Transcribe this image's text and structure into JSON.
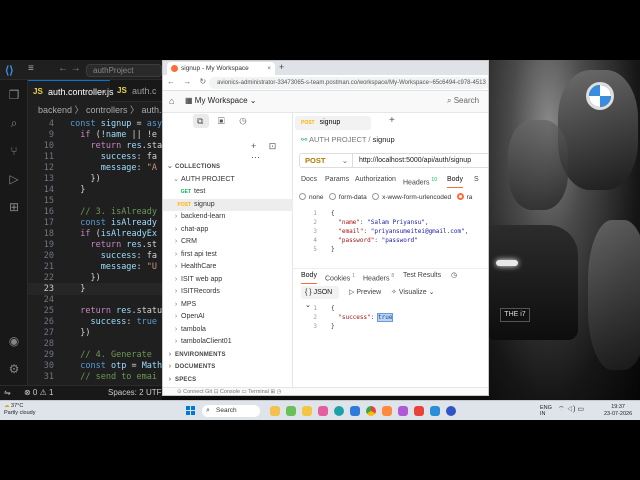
{
  "vscode": {
    "command_center": "authProject",
    "tabs": [
      {
        "label": "auth.controller.js"
      },
      {
        "label": "auth.c"
      }
    ],
    "breadcrumb": "backend 〉 controllers 〉 auth.c",
    "code": [
      {
        "n": "4",
        "html": "<span class='kw'>const</span> <span class='var'>signup</span> = <span class='kw'>async</span>"
      },
      {
        "n": "9",
        "html": "  <span class='kw2'>if</span> (!<span class='var'>name</span> || !e"
      },
      {
        "n": "10",
        "html": "    <span class='kw2'>return</span> <span class='var'>res</span>.sta"
      },
      {
        "n": "11",
        "html": "      <span class='var'>success</span>: fa"
      },
      {
        "n": "12",
        "html": "      <span class='var'>message</span>: <span class='str'>\"A</span>"
      },
      {
        "n": "13",
        "html": "    })"
      },
      {
        "n": "14",
        "html": "  }"
      },
      {
        "n": "15",
        "html": ""
      },
      {
        "n": "16",
        "html": "  <span class='cm'>// 3. isAlready</span>"
      },
      {
        "n": "17",
        "html": "  <span class='kw'>const</span> <span class='var'>isAlready</span>"
      },
      {
        "n": "18",
        "html": "  <span class='kw2'>if</span> (<span class='var'>isAlreadyEx</span>"
      },
      {
        "n": "19",
        "html": "    <span class='kw2'>return</span> <span class='var'>res</span>.st"
      },
      {
        "n": "20",
        "html": "      <span class='var'>success</span>: fa"
      },
      {
        "n": "21",
        "html": "      <span class='var'>message</span>: <span class='str'>\"U</span>"
      },
      {
        "n": "22",
        "html": "    })"
      },
      {
        "n": "23",
        "html": "  }"
      },
      {
        "n": "24",
        "html": ""
      },
      {
        "n": "25",
        "html": "  <span class='kw2'>return</span> <span class='var'>res</span>.statu"
      },
      {
        "n": "26",
        "html": "    <span class='var'>success</span>: <span class='kw'>true</span>"
      },
      {
        "n": "27",
        "html": "  })"
      },
      {
        "n": "28",
        "html": ""
      },
      {
        "n": "29",
        "html": "  <span class='cm'>// 4. Generate</span>"
      },
      {
        "n": "30",
        "html": "  <span class='kw'>const</span> <span class='var'>otp</span> = <span class='var'>Math</span>"
      },
      {
        "n": "31",
        "html": "  <span class='cm'>// send to emai</span>"
      }
    ],
    "current_line": "23",
    "status": {
      "errors": "⊗ 0 ⚠ 1",
      "spaces": "Spaces: 2",
      "enc": "UTF"
    }
  },
  "postman": {
    "browser_tab": "signup - My Workspace",
    "url": "avionics-administrator-33473065-s-team.postman.co/workspace/My-Workspace~65c6494-c978-4513",
    "workspace": "My Workspace",
    "search": "Search",
    "sidebar": {
      "collections_label": "COLLECTIONS",
      "root": "AUTH PROJECT",
      "requests": [
        {
          "method": "GET",
          "label": "test"
        },
        {
          "method": "POST",
          "label": "signup"
        }
      ],
      "folders": [
        "backend-learn",
        "chat-app",
        "CRM",
        "first api test",
        "HealthCare",
        "ISIT web app",
        "ISITRecords",
        "MPS",
        "OpenAI",
        "tambola",
        "tambolaClient01"
      ],
      "sections": [
        "ENVIRONMENTS",
        "DOCUMENTS",
        "SPECS",
        "FLOWS"
      ]
    },
    "request_tab": {
      "method": "POST",
      "label": "signup"
    },
    "breadcrumb": {
      "collection": "AUTH PROJECT",
      "request": "signup"
    },
    "method": "POST",
    "request_url": "http://localhost:5000/api/auth/signup",
    "tabs": [
      "Docs",
      "Params",
      "Authorization",
      "Headers",
      "Body",
      "S"
    ],
    "headers_count": "10",
    "body_modes": [
      "none",
      "form-data",
      "x-www-form-urlencoded",
      "ra"
    ],
    "body_lines": [
      {
        "n": "1",
        "html": "{"
      },
      {
        "n": "2",
        "html": "  <span class='jk'>\"name\"</span>: <span class='jv'>\"Salam Priyansu\"</span>,"
      },
      {
        "n": "3",
        "html": "  <span class='jk'>\"email\"</span>: <span class='jv'>\"priyansumeitei@gmail.com\"</span>,"
      },
      {
        "n": "4",
        "html": "  <span class='jk'>\"password\"</span>: <span class='jv'>\"password\"</span>"
      },
      {
        "n": "5",
        "html": "}"
      }
    ],
    "response_tabs": [
      "Body",
      "Cookies",
      "Headers",
      "Test Results"
    ],
    "cookies_count": "1",
    "headers_resp_count": "8",
    "format": "{ } JSON",
    "preview": "Preview",
    "visualize": "Visualize",
    "response_lines": [
      {
        "n": "1",
        "html": "{"
      },
      {
        "n": "2",
        "html": "  <span class='jk'>\"success\"</span>: <span class='sel-true'>true</span>"
      },
      {
        "n": "3",
        "html": "}"
      }
    ],
    "bottom": "⊙ Connect Git    ⊡ Console    ▭ Terminal    ⊞    ◷"
  },
  "wallpaper": {
    "plate": "THE i7"
  },
  "taskbar": {
    "temp": "37°C",
    "weather": "Partly cloudy",
    "search": "Search",
    "lang": "ENG",
    "region": "IN",
    "time": "19:37",
    "date": "23-07-2026"
  }
}
